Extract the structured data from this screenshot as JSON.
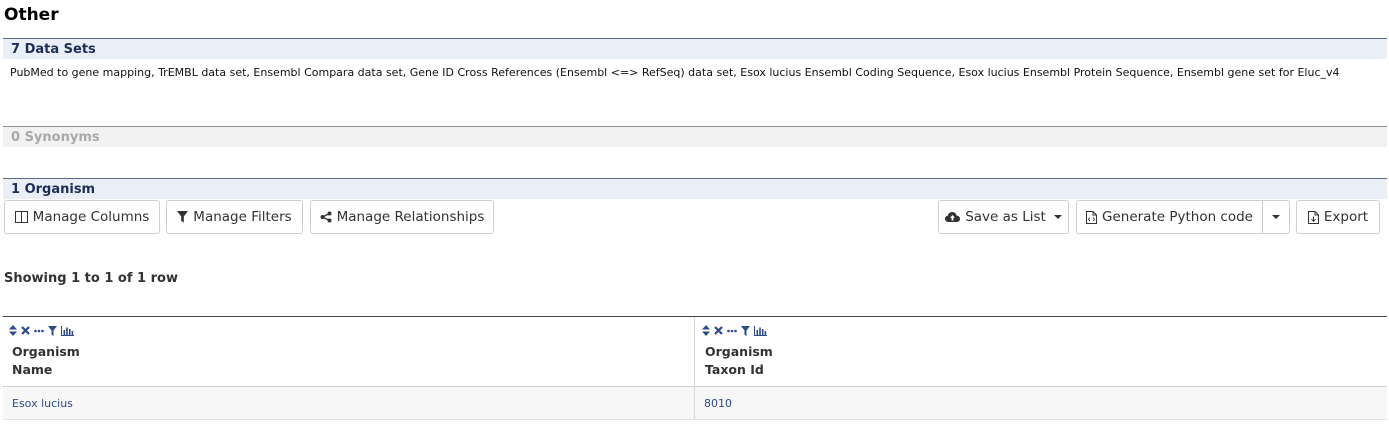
{
  "page": {
    "title": "Other"
  },
  "datasets": {
    "heading": "7 Data Sets",
    "text": "PubMed to gene mapping, TrEMBL data set, Ensembl Compara data set, Gene ID Cross References (Ensembl <=> RefSeq) data set, Esox lucius Ensembl Coding Sequence, Esox lucius Ensembl Protein Sequence, Ensembl gene set for Eluc_v4"
  },
  "synonyms": {
    "heading": "0 Synonyms"
  },
  "organism": {
    "heading": "1 Organism"
  },
  "toolbar": {
    "manage_columns": "Manage Columns",
    "manage_filters": "Manage Filters",
    "manage_relationships": "Manage Relationships",
    "save_as_list": "Save as List",
    "generate_code": "Generate Python code",
    "export": "Export"
  },
  "table": {
    "showing": "Showing 1 to 1 of 1 row",
    "columns": [
      {
        "line1": "Organism",
        "line2": "Name"
      },
      {
        "line1": "Organism",
        "line2": "Taxon Id"
      }
    ],
    "rows": [
      [
        "Esox lucius",
        "8010"
      ]
    ]
  },
  "colors": {
    "accent": "#1e2d55",
    "header_bg": "#eaeef6",
    "link": "#2d4a8a"
  }
}
